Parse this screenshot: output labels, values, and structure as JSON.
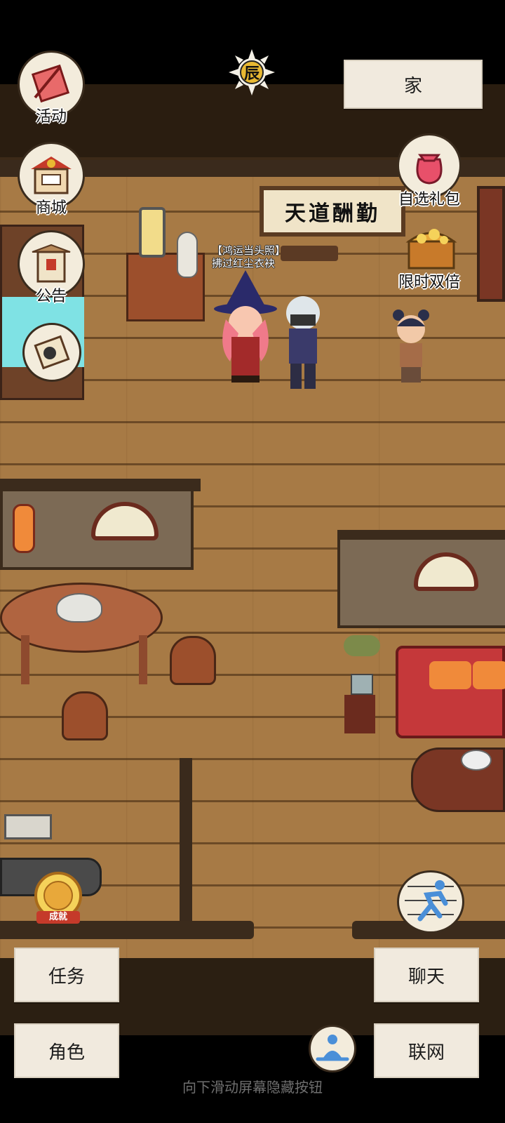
{
  "time_indicator": {
    "label": "辰"
  },
  "location": {
    "label": "家"
  },
  "left_menu": [
    {
      "label": "活动",
      "icon": "banner-flag-icon"
    },
    {
      "label": "商城",
      "icon": "shop-stall-icon"
    },
    {
      "label": "公告",
      "icon": "notice-board-icon"
    },
    {
      "label": "",
      "icon": "scroll-icon"
    }
  ],
  "right_menu": [
    {
      "label": "自选礼包",
      "icon": "gift-pouch-icon"
    },
    {
      "label": "限时双倍",
      "icon": "treasure-chest-icon"
    }
  ],
  "scene": {
    "plaque_text": "天道酬勤",
    "character_title_line1": "【鸿运当头照】",
    "character_title_line2": "拂过红尘衣袂"
  },
  "achievement": {
    "label": "成就"
  },
  "run_button": {
    "icon": "running-person-icon"
  },
  "meditate_button": {
    "icon": "meditation-icon"
  },
  "bottom_buttons": {
    "task": "任务",
    "chat": "聊天",
    "character": "角色",
    "online": "联网"
  },
  "hint_text": "向下滑动屏幕隐藏按钮",
  "colors": {
    "floor": "#a77a45",
    "wall": "#7c6a55",
    "dark_wood": "#3a2a1c",
    "paper": "#f1eade"
  }
}
